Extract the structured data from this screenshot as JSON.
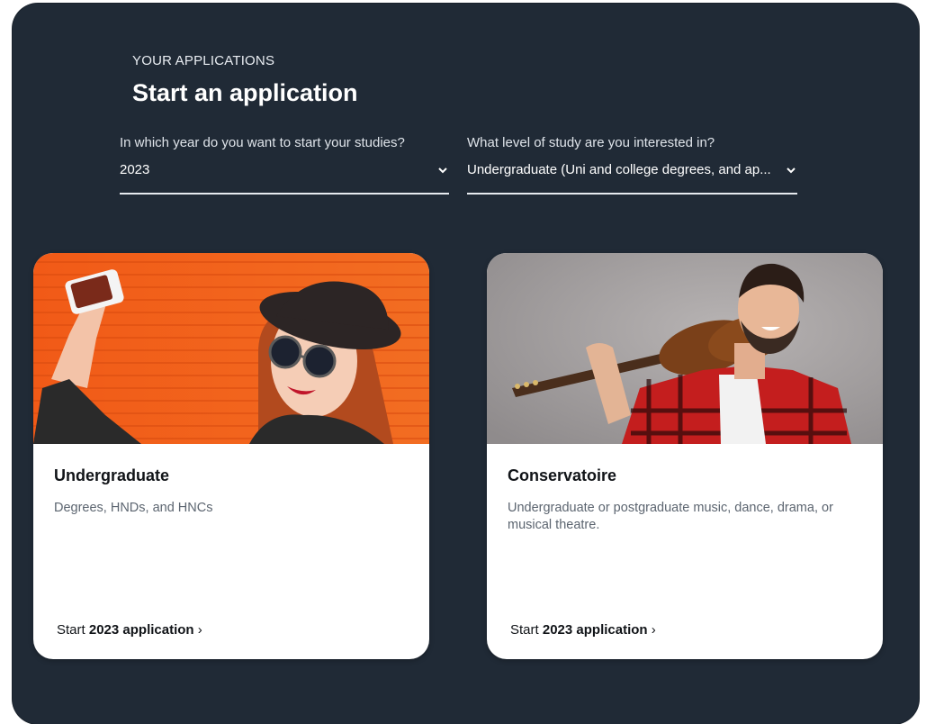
{
  "header": {
    "eyebrow": "YOUR APPLICATIONS",
    "title": "Start an application"
  },
  "filters": {
    "year": {
      "label": "In which year do you want to start your studies?",
      "value": "2023"
    },
    "level": {
      "label": "What level of study are you interested in?",
      "value": "Undergraduate (Uni and college degrees, and ap..."
    }
  },
  "cards": [
    {
      "title": "Undergraduate",
      "description": "Degrees, HNDs, and HNCs",
      "link_prefix": "Start",
      "link_year": "2023 application",
      "link_suffix": "›"
    },
    {
      "title": "Conservatoire",
      "description": "Undergraduate or postgraduate music, dance, drama, or musical theatre.",
      "link_prefix": "Start",
      "link_year": "2023 application",
      "link_suffix": "›"
    }
  ],
  "colors": {
    "panel": "#202a36",
    "card": "#ffffff",
    "accent_orange": "#f2601c"
  },
  "icons": {
    "dropdown": "chevron-down-icon"
  }
}
